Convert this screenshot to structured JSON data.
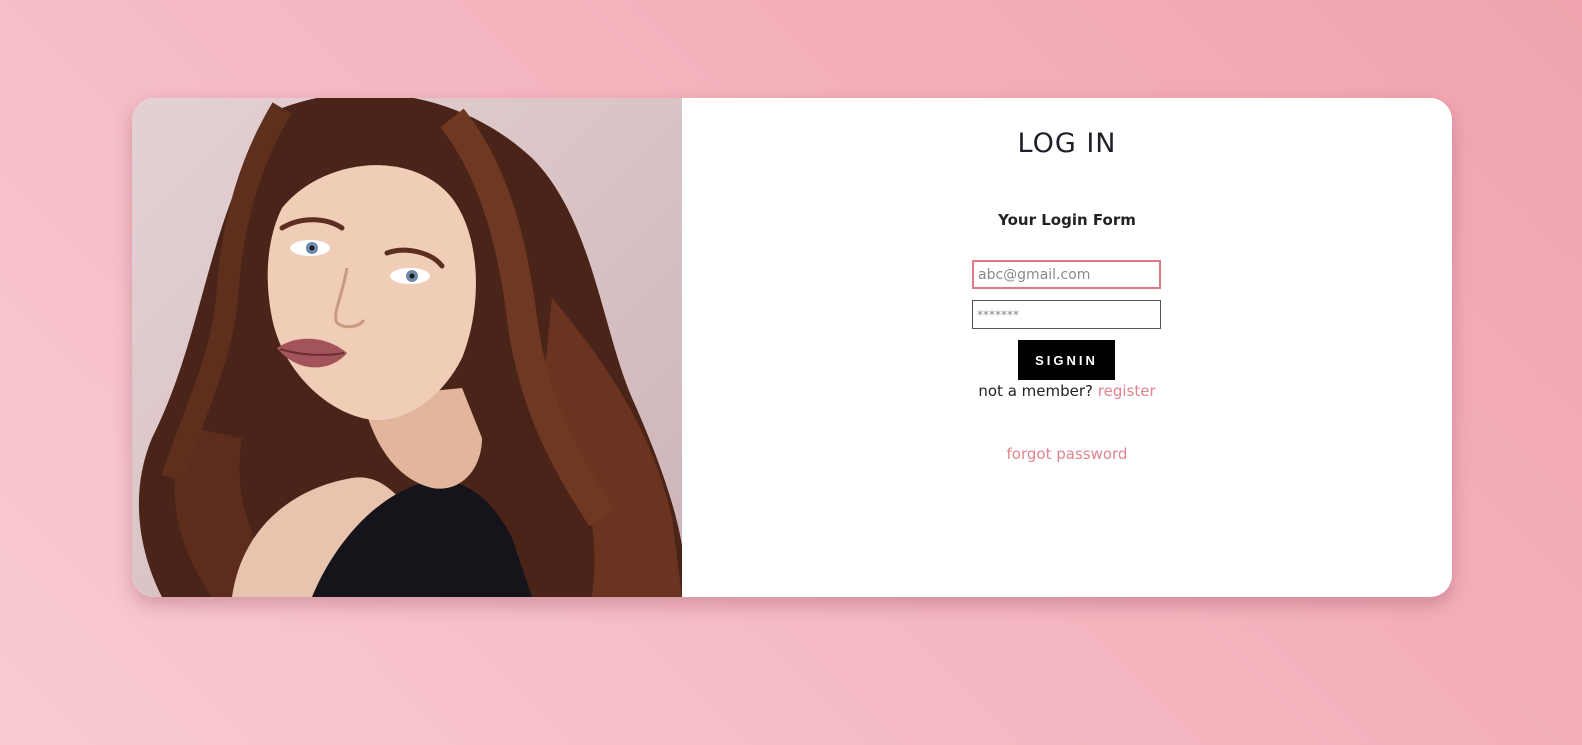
{
  "login": {
    "title": "LOG IN",
    "subtitle": "Your Login Form",
    "email_placeholder": "abc@gmail.com",
    "password_placeholder": "*******",
    "signin_label": "SIGNIN",
    "member_prompt": "not a member?",
    "register_link": "register",
    "forgot_link": "forgot password"
  },
  "colors": {
    "accent": "#e0848f",
    "button": "#000000",
    "background_gradient": [
      "#f9cbd3",
      "#f0a3ae"
    ]
  }
}
